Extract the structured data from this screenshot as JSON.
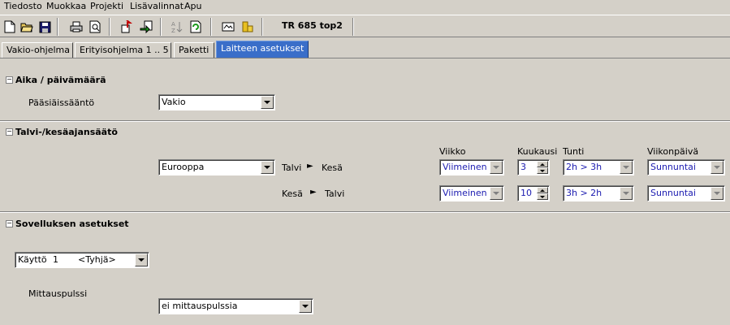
{
  "menu": [
    "Tiedosto",
    "Muokkaa",
    "Projekti",
    "Lisävalinnat",
    "Apu"
  ],
  "toolbar": {
    "title": "TR 685 top2",
    "icons": [
      "new-file-icon",
      "open-folder-icon",
      "save-icon",
      "print-icon",
      "print-preview-icon",
      "upload-icon",
      "download-icon",
      "sort-icon",
      "refresh-icon",
      "device-icon",
      "coins-icon"
    ]
  },
  "tabs": [
    {
      "label": "Vakio-ohjelma",
      "active": false
    },
    {
      "label": "Erityisohjelma 1 .. 5",
      "active": false
    },
    {
      "label": "Paketti",
      "active": false
    },
    {
      "label": "Laitteen asetukset",
      "active": true
    }
  ],
  "sections": {
    "time_date": {
      "title": "Aika / päivämäärä",
      "easter_label": "Pääsiäissääntö",
      "easter_value": "Vakio"
    },
    "dst": {
      "title": "Talvi-/kesäajansäätö",
      "region_value": "Eurooppa",
      "col_week": "Viikko",
      "col_month": "Kuukausi",
      "col_hour": "Tunti",
      "col_weekday": "Viikonpäivä",
      "row1": {
        "from": "Talvi",
        "arrow": "►",
        "to": "Kesä",
        "week": "Viimeinen",
        "month": "3",
        "hour": "2h > 3h",
        "weekday": "Sunnuntai"
      },
      "row2": {
        "from": "Kesä",
        "arrow": "►",
        "to": "Talvi",
        "week": "Viimeinen",
        "month": "10",
        "hour": "3h > 2h",
        "weekday": "Sunnuntai"
      }
    },
    "app": {
      "title": "Sovelluksen asetukset",
      "usage_label": "Käyttö",
      "usage_number": "1",
      "usage_value": "<Tyhjä>",
      "pulse_label": "Mittauspulssi",
      "pulse_value": "ei mittauspulssia"
    }
  },
  "colors": {
    "active_tab": "#3a6ec9",
    "disabled_value_text": "#1b1bb0",
    "background": "#d4d0c8"
  }
}
